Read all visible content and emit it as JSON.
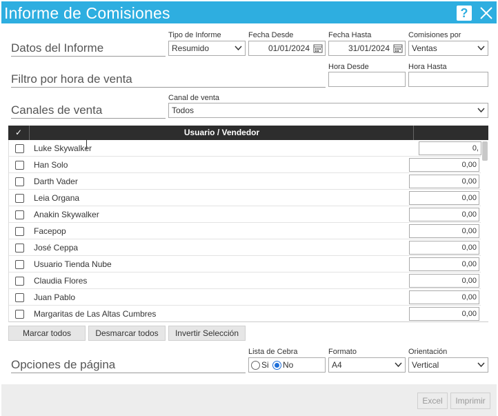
{
  "window": {
    "title": "Informe de Comisiones",
    "help_glyph": "?",
    "close_glyph": "✕"
  },
  "datos": {
    "section_title": "Datos del Informe",
    "tipo": {
      "label": "Tipo de Informe",
      "value": "Resumido"
    },
    "fecha_desde": {
      "label": "Fecha Desde",
      "value": "01/01/2024"
    },
    "fecha_hasta": {
      "label": "Fecha Hasta",
      "value": "31/01/2024"
    },
    "comisiones": {
      "label": "Comisiones por",
      "value": "Ventas"
    }
  },
  "filtro": {
    "section_title": "Filtro por hora de venta",
    "hora_desde": {
      "label": "Hora Desde",
      "value": ""
    },
    "hora_hasta": {
      "label": "Hora Hasta",
      "value": ""
    }
  },
  "canales": {
    "section_title": "Canales de venta",
    "canal": {
      "label": "Canal de venta",
      "value": "Todos"
    }
  },
  "table": {
    "check_header": "✓",
    "user_header": "Usuario / Vendedor",
    "rows": [
      {
        "name": "Luke Skywalker",
        "value": "0,"
      },
      {
        "name": "Han Solo",
        "value": "0,00"
      },
      {
        "name": "Darth Vader",
        "value": "0,00"
      },
      {
        "name": "Leia Organa",
        "value": "0,00"
      },
      {
        "name": "Anakin Skywalker",
        "value": "0,00"
      },
      {
        "name": "Facepop",
        "value": "0,00"
      },
      {
        "name": "José Ceppa",
        "value": "0,00"
      },
      {
        "name": "Usuario Tienda Nube",
        "value": "0,00"
      },
      {
        "name": "Claudia Flores",
        "value": "0,00"
      },
      {
        "name": "Juan Pablo",
        "value": "0,00"
      },
      {
        "name": "Margaritas de Las Altas Cumbres",
        "value": "0,00"
      }
    ]
  },
  "buttons": {
    "marcar": "Marcar todos",
    "desmarcar": "Desmarcar todos",
    "invertir": "Invertir Selección"
  },
  "opciones": {
    "section_title": "Opciones de página",
    "lista_cebra": {
      "label": "Lista de Cebra",
      "si": "Si",
      "no": "No",
      "selected": "No"
    },
    "formato": {
      "label": "Formato",
      "value": "A4"
    },
    "orientacion": {
      "label": "Orientación",
      "value": "Vertical"
    }
  },
  "footer": {
    "excel": "Excel",
    "imprimir": "Imprimir"
  },
  "colors": {
    "accent": "#2eaee0",
    "header_dark": "#2d2d2d",
    "radio_blue": "#1e6fd9"
  }
}
